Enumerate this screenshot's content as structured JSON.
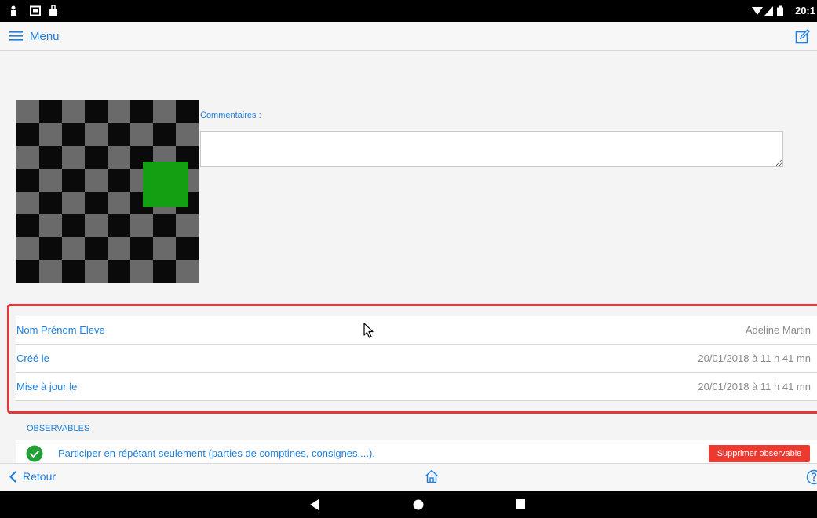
{
  "status_bar": {
    "time": "20:1"
  },
  "nav_bar": {
    "menu_label": "Menu"
  },
  "comments": {
    "label": "Commentaires :",
    "value": ""
  },
  "info_rows": [
    {
      "label": "Nom Prénom Eleve",
      "value": "Adeline Martin"
    },
    {
      "label": "Créé le",
      "value": "20/01/2018 à 11 h 41 mn"
    },
    {
      "label": "Mise à jour le",
      "value": "20/01/2018 à 11 h 41 mn"
    }
  ],
  "observables": {
    "header": "OBSERVABLES",
    "items": [
      {
        "text": "Participer en répétant seulement (parties de comptines, consignes,...).",
        "delete_label": "Supprimer observable"
      }
    ]
  },
  "bottom_bar": {
    "back_label": "Retour"
  },
  "icons": {
    "menu": "hamburger-icon",
    "edit": "edit-icon",
    "back": "chevron-left-icon",
    "home": "home-icon",
    "help": "help-icon",
    "check": "check-circle-icon"
  },
  "colors": {
    "accent": "#1e7fe0",
    "highlight": "#e0373a",
    "delete": "#ec3a30",
    "check": "#22a036",
    "image_square": "#12a012"
  }
}
